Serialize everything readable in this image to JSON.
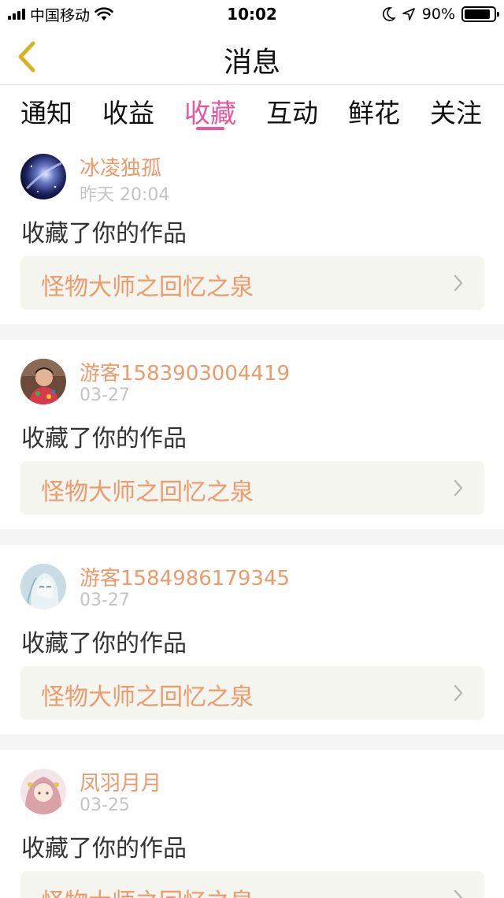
{
  "status_bar": {
    "carrier": "中国移动",
    "time": "10:02",
    "battery": "90%",
    "battery_level": 0.9,
    "icons": [
      "signal-icon",
      "wifi-icon",
      "moon-icon",
      "location-arrow-icon",
      "battery-icon"
    ]
  },
  "nav": {
    "title": "消息",
    "back_icon": "chevron-left-icon",
    "accent_color": "#e8569b"
  },
  "tabs": [
    {
      "label": "通知",
      "active": false
    },
    {
      "label": "收益",
      "active": false
    },
    {
      "label": "收藏",
      "active": true
    },
    {
      "label": "互动",
      "active": false
    },
    {
      "label": "鲜花",
      "active": false
    },
    {
      "label": "关注",
      "active": false
    }
  ],
  "messages": [
    {
      "user": "冰凌独孤",
      "time": "昨天 20:04",
      "action": "收藏了你的作品",
      "work": "怪物大师之回忆之泉"
    },
    {
      "user": "游客1583903004419",
      "time": "03-27",
      "action": "收藏了你的作品",
      "work": "怪物大师之回忆之泉"
    },
    {
      "user": "游客1584986179345",
      "time": "03-27",
      "action": "收藏了你的作品",
      "work": "怪物大师之回忆之泉"
    },
    {
      "user": "凤羽月月",
      "time": "03-25",
      "action": "收藏了你的作品",
      "work": "怪物大师之回忆之泉"
    }
  ],
  "colors": {
    "username": "#ee9a6a",
    "work_title": "#ee9a6a",
    "timestamp": "#c4c4c4",
    "work_card_bg": "#f5f5ef"
  }
}
